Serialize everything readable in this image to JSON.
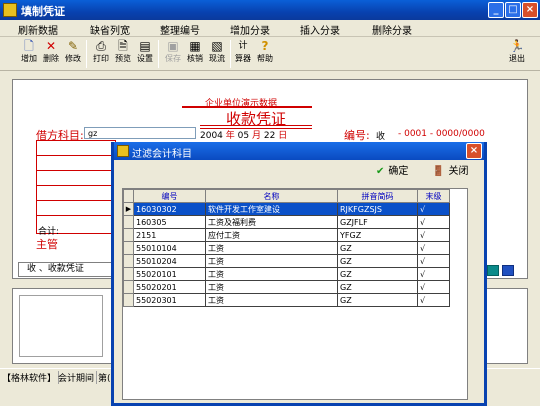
{
  "window": {
    "title": "填制凭证"
  },
  "menu": [
    "刷新数据",
    "缺省列宽",
    "整理编号",
    "增加分录",
    "插入分录",
    "删除分录"
  ],
  "toolbar": {
    "items": [
      {
        "label": "增加",
        "icon": "new-doc-icon"
      },
      {
        "label": "删除",
        "icon": "delete-x-icon"
      },
      {
        "label": "修改",
        "icon": "edit-icon"
      },
      {
        "label": "打印",
        "icon": "printer-icon"
      },
      {
        "label": "预览",
        "icon": "preview-icon"
      },
      {
        "label": "设置",
        "icon": "settings-icon"
      },
      {
        "label": "保存",
        "icon": "save-icon",
        "disabled": true
      },
      {
        "label": "核销",
        "icon": "verify-icon"
      },
      {
        "label": "现流",
        "icon": "cashflow-icon"
      },
      {
        "label": "算器",
        "icon": "calculator-icon"
      },
      {
        "label": "帮助",
        "icon": "help-icon"
      }
    ],
    "exit_label": "退出"
  },
  "voucher": {
    "company": "企业单位演示数据",
    "title": "收款凭证",
    "debit_label": "借方科目:",
    "debit_value": "gz",
    "date": {
      "year": "2004",
      "year_lbl": "年",
      "month": "05",
      "month_lbl": "月",
      "day": "22",
      "day_lbl": "日"
    },
    "number_label": "编号:",
    "number_type": "收",
    "number_value": "- 0001 - 0000/0000",
    "total_label": "合计:",
    "director_label": "主管",
    "summary_value": "收  、收款凭证"
  },
  "status": [
    "【格林软件】",
    "会计期间",
    "第("
  ],
  "dialog": {
    "title": "过滤会计科目",
    "ok_label": "确定",
    "close_label": "关闭",
    "columns": [
      "编号",
      "名称",
      "拼音简码",
      "末级"
    ],
    "rows": [
      [
        "16030302",
        "软件开发工作室建设",
        "RJKFGZSJS",
        "√"
      ],
      [
        "160305",
        "工资及福利费",
        "GZJFLF",
        "√"
      ],
      [
        "2151",
        "应付工资",
        "YFGZ",
        "√"
      ],
      [
        "55010104",
        "工资",
        "GZ",
        "√"
      ],
      [
        "55010204",
        "工资",
        "GZ",
        "√"
      ],
      [
        "55020101",
        "工资",
        "GZ",
        "√"
      ],
      [
        "55020201",
        "工资",
        "GZ",
        "√"
      ],
      [
        "55020301",
        "工资",
        "GZ",
        "√"
      ]
    ],
    "selected_row": 0
  },
  "colors": {
    "accent_red": "#d00000",
    "selection": "#0a50c8",
    "title_blue": "#0842b0"
  }
}
